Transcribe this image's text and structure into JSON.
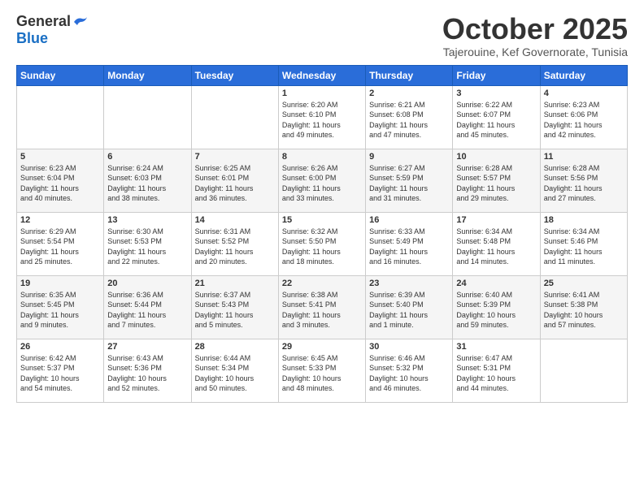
{
  "logo": {
    "general": "General",
    "blue": "Blue"
  },
  "title": "October 2025",
  "subtitle": "Tajerouine, Kef Governorate, Tunisia",
  "days": [
    "Sunday",
    "Monday",
    "Tuesday",
    "Wednesday",
    "Thursday",
    "Friday",
    "Saturday"
  ],
  "weeks": [
    [
      {
        "day": "",
        "content": ""
      },
      {
        "day": "",
        "content": ""
      },
      {
        "day": "",
        "content": ""
      },
      {
        "day": "1",
        "content": "Sunrise: 6:20 AM\nSunset: 6:10 PM\nDaylight: 11 hours\nand 49 minutes."
      },
      {
        "day": "2",
        "content": "Sunrise: 6:21 AM\nSunset: 6:08 PM\nDaylight: 11 hours\nand 47 minutes."
      },
      {
        "day": "3",
        "content": "Sunrise: 6:22 AM\nSunset: 6:07 PM\nDaylight: 11 hours\nand 45 minutes."
      },
      {
        "day": "4",
        "content": "Sunrise: 6:23 AM\nSunset: 6:06 PM\nDaylight: 11 hours\nand 42 minutes."
      }
    ],
    [
      {
        "day": "5",
        "content": "Sunrise: 6:23 AM\nSunset: 6:04 PM\nDaylight: 11 hours\nand 40 minutes."
      },
      {
        "day": "6",
        "content": "Sunrise: 6:24 AM\nSunset: 6:03 PM\nDaylight: 11 hours\nand 38 minutes."
      },
      {
        "day": "7",
        "content": "Sunrise: 6:25 AM\nSunset: 6:01 PM\nDaylight: 11 hours\nand 36 minutes."
      },
      {
        "day": "8",
        "content": "Sunrise: 6:26 AM\nSunset: 6:00 PM\nDaylight: 11 hours\nand 33 minutes."
      },
      {
        "day": "9",
        "content": "Sunrise: 6:27 AM\nSunset: 5:59 PM\nDaylight: 11 hours\nand 31 minutes."
      },
      {
        "day": "10",
        "content": "Sunrise: 6:28 AM\nSunset: 5:57 PM\nDaylight: 11 hours\nand 29 minutes."
      },
      {
        "day": "11",
        "content": "Sunrise: 6:28 AM\nSunset: 5:56 PM\nDaylight: 11 hours\nand 27 minutes."
      }
    ],
    [
      {
        "day": "12",
        "content": "Sunrise: 6:29 AM\nSunset: 5:54 PM\nDaylight: 11 hours\nand 25 minutes."
      },
      {
        "day": "13",
        "content": "Sunrise: 6:30 AM\nSunset: 5:53 PM\nDaylight: 11 hours\nand 22 minutes."
      },
      {
        "day": "14",
        "content": "Sunrise: 6:31 AM\nSunset: 5:52 PM\nDaylight: 11 hours\nand 20 minutes."
      },
      {
        "day": "15",
        "content": "Sunrise: 6:32 AM\nSunset: 5:50 PM\nDaylight: 11 hours\nand 18 minutes."
      },
      {
        "day": "16",
        "content": "Sunrise: 6:33 AM\nSunset: 5:49 PM\nDaylight: 11 hours\nand 16 minutes."
      },
      {
        "day": "17",
        "content": "Sunrise: 6:34 AM\nSunset: 5:48 PM\nDaylight: 11 hours\nand 14 minutes."
      },
      {
        "day": "18",
        "content": "Sunrise: 6:34 AM\nSunset: 5:46 PM\nDaylight: 11 hours\nand 11 minutes."
      }
    ],
    [
      {
        "day": "19",
        "content": "Sunrise: 6:35 AM\nSunset: 5:45 PM\nDaylight: 11 hours\nand 9 minutes."
      },
      {
        "day": "20",
        "content": "Sunrise: 6:36 AM\nSunset: 5:44 PM\nDaylight: 11 hours\nand 7 minutes."
      },
      {
        "day": "21",
        "content": "Sunrise: 6:37 AM\nSunset: 5:43 PM\nDaylight: 11 hours\nand 5 minutes."
      },
      {
        "day": "22",
        "content": "Sunrise: 6:38 AM\nSunset: 5:41 PM\nDaylight: 11 hours\nand 3 minutes."
      },
      {
        "day": "23",
        "content": "Sunrise: 6:39 AM\nSunset: 5:40 PM\nDaylight: 11 hours\nand 1 minute."
      },
      {
        "day": "24",
        "content": "Sunrise: 6:40 AM\nSunset: 5:39 PM\nDaylight: 10 hours\nand 59 minutes."
      },
      {
        "day": "25",
        "content": "Sunrise: 6:41 AM\nSunset: 5:38 PM\nDaylight: 10 hours\nand 57 minutes."
      }
    ],
    [
      {
        "day": "26",
        "content": "Sunrise: 6:42 AM\nSunset: 5:37 PM\nDaylight: 10 hours\nand 54 minutes."
      },
      {
        "day": "27",
        "content": "Sunrise: 6:43 AM\nSunset: 5:36 PM\nDaylight: 10 hours\nand 52 minutes."
      },
      {
        "day": "28",
        "content": "Sunrise: 6:44 AM\nSunset: 5:34 PM\nDaylight: 10 hours\nand 50 minutes."
      },
      {
        "day": "29",
        "content": "Sunrise: 6:45 AM\nSunset: 5:33 PM\nDaylight: 10 hours\nand 48 minutes."
      },
      {
        "day": "30",
        "content": "Sunrise: 6:46 AM\nSunset: 5:32 PM\nDaylight: 10 hours\nand 46 minutes."
      },
      {
        "day": "31",
        "content": "Sunrise: 6:47 AM\nSunset: 5:31 PM\nDaylight: 10 hours\nand 44 minutes."
      },
      {
        "day": "",
        "content": ""
      }
    ]
  ]
}
